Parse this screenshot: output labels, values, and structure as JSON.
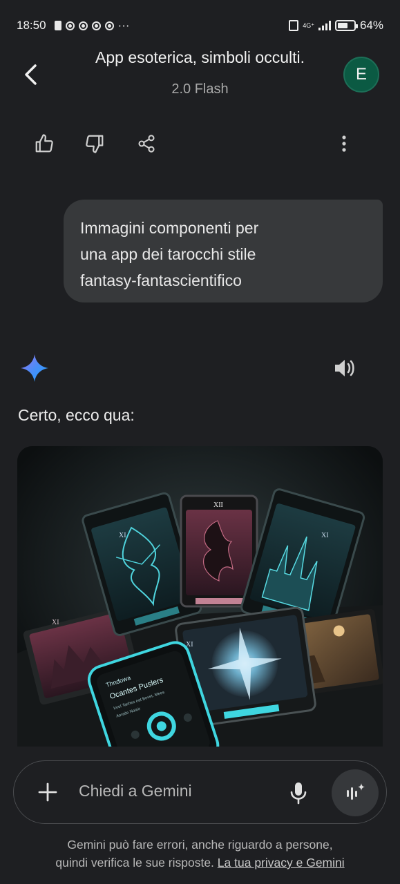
{
  "status_bar": {
    "time": "18:50",
    "more": "···",
    "network": "4G⁺",
    "battery": "64%",
    "battery_level": 0.64
  },
  "header": {
    "title": "App esoterica, simboli occulti.",
    "subtitle": "2.0 Flash",
    "avatar_initial": "E"
  },
  "user_message": {
    "lines": [
      "Immagini componenti per",
      "una app dei tarocchi stile",
      "fantasy-fantascientifico"
    ]
  },
  "response": {
    "text": "Certo, ecco qua:"
  },
  "image_card": {
    "card_numerals": [
      "XI",
      "XII",
      "XI",
      "XI",
      "XI"
    ],
    "phone_lines": [
      "Thndowa",
      "Ocantes Puslers",
      "Inrol Taches eat Bevet. Mees",
      "Aoraite Notoir"
    ]
  },
  "input": {
    "placeholder": "Chiedi a Gemini"
  },
  "disclaimer": {
    "line1": "Gemini può fare errori, anche riguardo a persone,",
    "line2": "quindi verifica le sue risposte.",
    "link": "La tua privacy e Gemini"
  },
  "colors": {
    "background": "#1e1f22",
    "bubble": "#37393b",
    "avatar": "#0b5a43",
    "accent_cyan": "#3fd6e0",
    "accent_pink": "#c9647f"
  }
}
